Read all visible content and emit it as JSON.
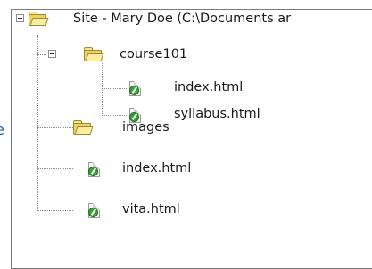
{
  "edge_fragment": "e",
  "tree": {
    "root": {
      "label": "Site - Mary Doe (C:\\Documents ar",
      "icon": "folder-icon"
    },
    "course101": {
      "label": "course101",
      "icon": "folder-icon"
    },
    "course101_index": {
      "label": "index.html",
      "icon": "html-file-icon"
    },
    "course101_syllabus": {
      "label": "syllabus.html",
      "icon": "html-file-icon"
    },
    "images": {
      "label": "images",
      "icon": "folder-icon"
    },
    "index": {
      "label": "index.html",
      "icon": "html-file-icon"
    },
    "vita": {
      "label": "vita.html",
      "icon": "html-file-icon"
    }
  }
}
